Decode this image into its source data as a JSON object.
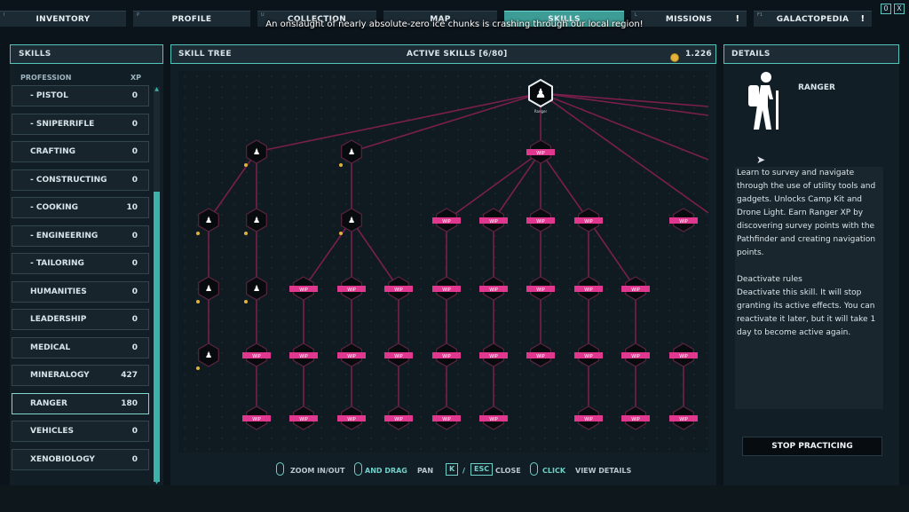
{
  "tabs": [
    {
      "key": "I",
      "label": "INVENTORY"
    },
    {
      "key": "P",
      "label": "PROFILE"
    },
    {
      "key": "U",
      "label": "COLLECTION"
    },
    {
      "key": "",
      "label": "MAP"
    },
    {
      "key": "",
      "label": "SKILLS"
    },
    {
      "key": "L",
      "label": "MISSIONS",
      "alert": "!"
    },
    {
      "key": "F1",
      "label": "GALACTOPEDIA",
      "alert": "!"
    }
  ],
  "notice": "An onslaught of nearly absolute-zero ice chunks is crashing through our local region!",
  "window_buttons": [
    "0",
    "X"
  ],
  "skills_panel": {
    "title": "SKILLS",
    "col_profession": "PROFESSION",
    "col_xp": "XP",
    "rows": [
      {
        "name": "- PISTOL",
        "xp": "0"
      },
      {
        "name": "- SNIPERRIFLE",
        "xp": "0"
      },
      {
        "name": "CRAFTING",
        "xp": "0"
      },
      {
        "name": "- CONSTRUCTING",
        "xp": "0"
      },
      {
        "name": "- COOKING",
        "xp": "10"
      },
      {
        "name": "- ENGINEERING",
        "xp": "0"
      },
      {
        "name": "- TAILORING",
        "xp": "0"
      },
      {
        "name": "HUMANITIES",
        "xp": "0"
      },
      {
        "name": "LEADERSHIP",
        "xp": "0"
      },
      {
        "name": "MEDICAL",
        "xp": "0"
      },
      {
        "name": "MINERALOGY",
        "xp": "427"
      },
      {
        "name": "RANGER",
        "xp": "180",
        "selected": true
      },
      {
        "name": "VEHICLES",
        "xp": "0"
      },
      {
        "name": "XENOBIOLOGY",
        "xp": "0"
      }
    ]
  },
  "tree_panel": {
    "title": "SKILL TREE",
    "active": "ACTIVE SKILLS [6/80]",
    "currency": "1.226",
    "root_label": "Ranger",
    "wip_label": "WIP"
  },
  "hints": {
    "zoom": "ZOOM IN/OUT",
    "and_drag": "AND DRAG",
    "pan": "PAN",
    "key_k": "K",
    "slash": "/",
    "key_esc": "ESC",
    "close": "CLOSE",
    "click": "CLICK",
    "view": "VIEW DETAILS"
  },
  "details": {
    "title": "DETAILS",
    "name": "RANGER",
    "description": "Learn to survey and navigate through the use of utility tools and gadgets. Unlocks Camp Kit and Drone Light. Earn Ranger XP by discovering survey points with the Pathfinder and creating navigation points.",
    "rule_title": "Deactivate rules",
    "rule_text": "Deactivate this skill. It will stop granting its active effects. You can reactivate it later, but it will take 1 day to become active again.",
    "button": "STOP PRACTICING"
  },
  "colors": {
    "accent": "#53c6bc",
    "wip": "#e0378f",
    "edge": "#7a1f4c",
    "coin": "#e3b23a"
  }
}
